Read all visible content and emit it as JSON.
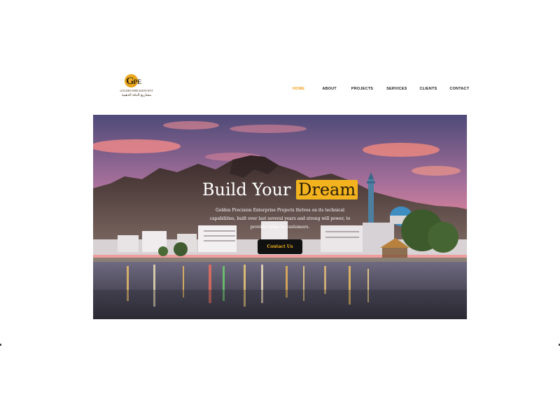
{
  "logo": {
    "mark": "G",
    "mark_suffix": "PE",
    "company_name": "GOLDEN PRECISION ENT",
    "arabic_name": "مشاريع الدقة الذهبية"
  },
  "nav": {
    "items": [
      {
        "label": "HOME",
        "active": true
      },
      {
        "label": "ABOUT",
        "active": false
      },
      {
        "label": "PROJECTS",
        "active": false
      },
      {
        "label": "SERVICES",
        "active": false
      },
      {
        "label": "CLIENTS",
        "active": false
      },
      {
        "label": "CONTACT",
        "active": false
      }
    ]
  },
  "hero": {
    "title_prefix": "Build Your",
    "title_highlight": "Dream",
    "subtitle": "Golden Precision Enterprise Projects thrives on its technical capabilities, built over last several years and strong will power, to provide value to customers.",
    "button_label": "Contact Us"
  },
  "colors": {
    "accent": "#f2b31e",
    "nav_active": "#f0a21b",
    "button_bg": "#111111"
  }
}
